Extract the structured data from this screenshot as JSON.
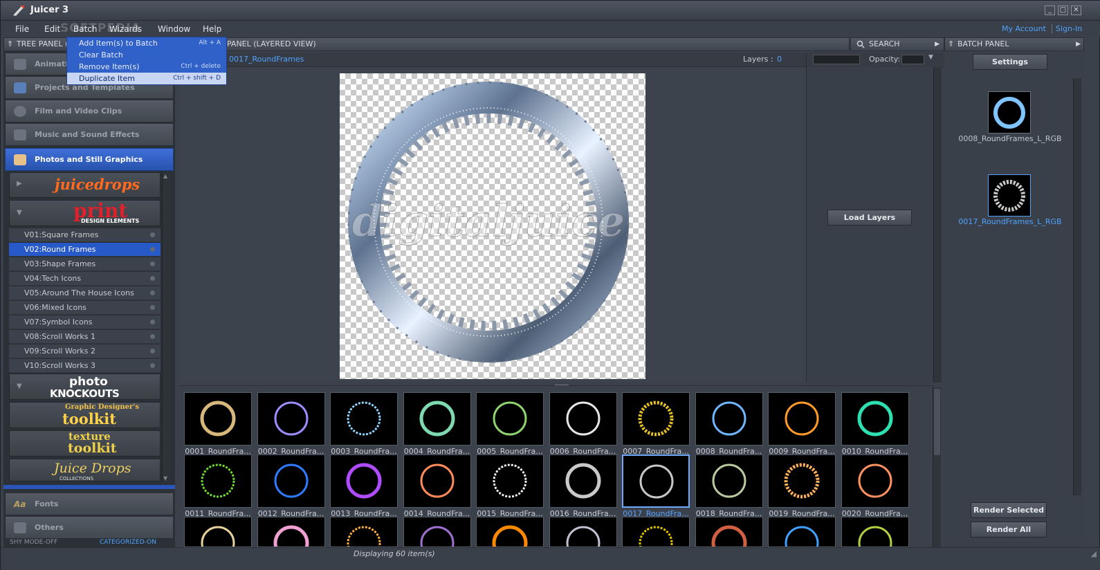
{
  "app": {
    "title": "Juicer 3"
  },
  "window": {
    "minimize": "_",
    "maximize": "□",
    "close": "✕"
  },
  "menu": [
    "File",
    "Edit",
    "Batch",
    "Wizards",
    "Window",
    "Help"
  ],
  "account": {
    "my_account": "My Account",
    "sign_in": "Sign-In"
  },
  "watermark": "SOFTPEDIA",
  "batch_menu": {
    "items": [
      {
        "label": "Add Item(s) to Batch",
        "shortcut": "Alt + A"
      },
      {
        "label": "Clear Batch",
        "shortcut": ""
      },
      {
        "label": "Remove Item(s)",
        "shortcut": "Ctrl + delete"
      },
      {
        "label": "Duplicate Item",
        "shortcut": "Ctrl + shift + D"
      }
    ]
  },
  "tree_panel": {
    "title": "TREE PANEL (",
    "categories": [
      {
        "label": "Animati"
      },
      {
        "label": "Projects and Templates"
      },
      {
        "label": "Film and Video Clips"
      },
      {
        "label": "Music and Sound Effects"
      },
      {
        "label": "Photos and Still Graphics"
      }
    ],
    "brands": {
      "juicedrops": "juicedrops",
      "print": "print",
      "print_sub": "DESIGN ELEMENTS",
      "photo": "photo",
      "knockouts": "KNOCKOUTS",
      "gd1": "Graphic Designer's",
      "gd2": "toolkit",
      "tex1": "texture",
      "tex2": "toolkit",
      "jd": "Juice Drops",
      "jd_sub": "COLLECTIONS"
    },
    "volumes": [
      "V01:Square Frames",
      "V02:Round Frames",
      "V03:Shape Frames",
      "V04:Tech Icons",
      "V05:Around The House Icons",
      "V06:Mixed Icons",
      "V07:Symbol Icons",
      "V08:Scroll Works 1",
      "V09:Scroll Works 2",
      "V10:Scroll Works 3"
    ],
    "bottom": [
      {
        "label": "Fonts"
      },
      {
        "label": "Others"
      }
    ],
    "shy_mode": "SHY MODE-OFF",
    "categorized": "CATEGORIZED-ON"
  },
  "preview_panel": {
    "title": "PANEL (LAYERED VIEW)",
    "item": "0017_RoundFrames",
    "layers_label": "Layers :",
    "layers_count": "0",
    "search": "SEARCH",
    "opacity_label": "Opacity:",
    "load_layers": "Load Layers",
    "watermark": "digitaljuice"
  },
  "thumbnails": [
    "0001_RoundFra...",
    "0002_RoundFra...",
    "0003_RoundFra...",
    "0004_RoundFra...",
    "0005_RoundFra...",
    "0006_RoundFra...",
    "0007_RoundFra...",
    "0008_RoundFra...",
    "0009_RoundFra...",
    "0010_RoundFra...",
    "0011_RoundFra...",
    "0012_RoundFra...",
    "0013_RoundFra...",
    "0014_RoundFra...",
    "0015_RoundFra...",
    "0016_RoundFra...",
    "0017_RoundFra...",
    "0018_RoundFra...",
    "0019_RoundFra...",
    "0020_RoundFra..."
  ],
  "thumb_colors": [
    "#d8b87a",
    "#9b8cff",
    "#8ed6ff",
    "#7fd9b0",
    "#8fd36e",
    "#e6e6e6",
    "#e3c12a",
    "#6fb6ff",
    "#ff9a2a",
    "#2ee0b0",
    "#6fdc2e",
    "#2f7bff",
    "#b14bff",
    "#ff8c5a",
    "#f0f0f0",
    "#c9c9c9",
    "#c7c7c7",
    "#b9c9a0",
    "#ffb05a",
    "#ff9060",
    "#e6d29a",
    "#f0a0d0",
    "#ffb040",
    "#a070d0",
    "#ff8a00",
    "#c0c0d0",
    "#e6c800",
    "#d06040",
    "#40a0ff",
    "#b0d040"
  ],
  "batch_panel": {
    "title": "BATCH PANEL",
    "settings": "Settings",
    "items": [
      {
        "label": "0008_RoundFrames_L_RGB",
        "color": "#7fc4ff"
      },
      {
        "label": "0017_RoundFrames_L_RGB",
        "color": "#c9c9c9"
      }
    ],
    "render_selected": "Render Selected",
    "render_all": "Render All"
  },
  "status": "Displaying 60 item(s)"
}
